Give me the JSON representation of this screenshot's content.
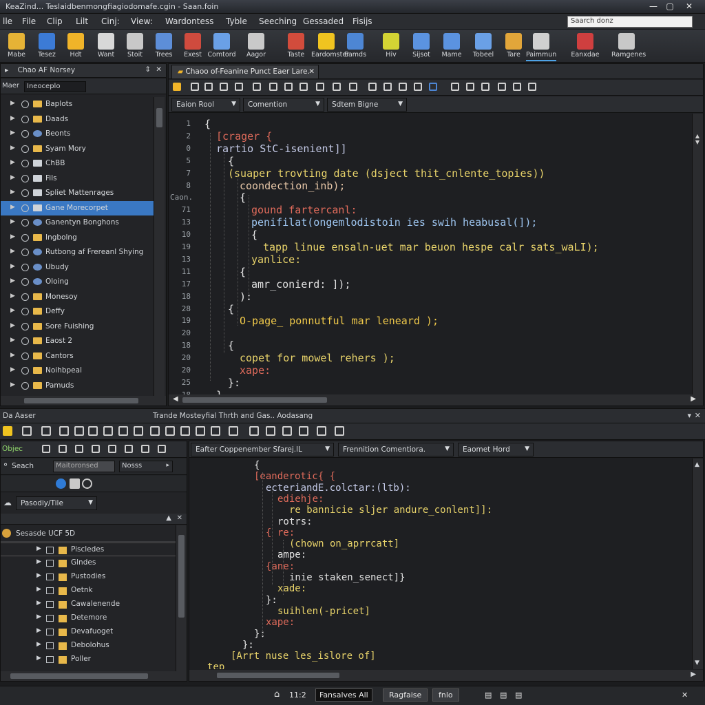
{
  "window": {
    "title": "KeaZind... Teslaidbenmongfiagiodomafe.cgin - Saan.foin"
  },
  "menu": [
    "lle",
    "File",
    "Clip",
    "Lilt",
    "Cinj:",
    "View:",
    "Wardontess",
    "Tyble",
    "Seeching",
    "Gessaded",
    "Fisijs"
  ],
  "search": {
    "placeholder": "Saarch donz"
  },
  "toolbar": [
    {
      "label": "Mabe",
      "color": "#e6b336"
    },
    {
      "label": "Tesez",
      "color": "#3c7bd6"
    },
    {
      "label": "Hdt",
      "color": "#f0b429"
    },
    {
      "label": "Want",
      "color": "#d8d8d8"
    },
    {
      "label": "Stoit",
      "color": "#c8c8c8"
    },
    {
      "label": "Trees",
      "color": "#5d8ed8"
    },
    {
      "label": "Exest",
      "color": "#cf4b3e"
    },
    {
      "label": "Comtord",
      "color": "#6aa0e6"
    },
    {
      "label": "Aagor",
      "color": "#c9c9c9"
    },
    {
      "label": "Taste",
      "color": "#d24c3c"
    },
    {
      "label": "Eardomster",
      "color": "#f0c420"
    },
    {
      "label": "Eamds",
      "color": "#4d86d4"
    },
    {
      "label": "Hiv",
      "color": "#d4d434"
    },
    {
      "label": "Sijsot",
      "color": "#5b93e0"
    },
    {
      "label": "Mame",
      "color": "#5b93e0"
    },
    {
      "label": "Tobeel",
      "color": "#6aa0e6"
    },
    {
      "label": "Tare",
      "color": "#e2a63a"
    },
    {
      "label": "Paimmun",
      "color": "#d0d0d0"
    },
    {
      "label": "Eanxdae",
      "color": "#cf3f3f"
    },
    {
      "label": "Ramgenes",
      "color": "#c8c8c8"
    }
  ],
  "left_panel": {
    "title": "Chao AF Norsey",
    "filter_label": "Maer",
    "filter_value": "Ineoceplo",
    "items": [
      {
        "label": "Baplots",
        "icon": "folder-icon",
        "selected": false
      },
      {
        "label": "Daads",
        "icon": "folder-icon",
        "selected": false
      },
      {
        "label": "Beonts",
        "icon": "gear-icon",
        "selected": false
      },
      {
        "label": "Syam Mory",
        "icon": "folder-icon",
        "selected": false
      },
      {
        "label": "ChBB",
        "icon": "file-icon",
        "selected": false
      },
      {
        "label": "Fils",
        "icon": "file-icon",
        "selected": false
      },
      {
        "label": "Spliet Mattenrages",
        "icon": "file-icon",
        "selected": false
      },
      {
        "label": "Gane Morecorpet",
        "icon": "file-icon",
        "selected": true
      },
      {
        "label": "Ganentyn Bonghons",
        "icon": "gear-icon",
        "selected": false
      },
      {
        "label": "Ingbolng",
        "icon": "folder-icon",
        "selected": false
      },
      {
        "label": "Rutbong af Frereanl Shying",
        "icon": "gear-icon",
        "selected": false
      },
      {
        "label": "Ubudy",
        "icon": "gear-icon",
        "selected": false
      },
      {
        "label": "Oloing",
        "icon": "gear-icon",
        "selected": false
      },
      {
        "label": "Monesoy",
        "icon": "folder-icon",
        "selected": false
      },
      {
        "label": "Deffy",
        "icon": "folder-icon",
        "selected": false
      },
      {
        "label": "Sore Fuishing",
        "icon": "folder-icon",
        "selected": false
      },
      {
        "label": "Eaost 2",
        "icon": "folder-icon",
        "selected": false
      },
      {
        "label": "Cantors",
        "icon": "folder-icon",
        "selected": false
      },
      {
        "label": "Noihbpeal",
        "icon": "folder-icon",
        "selected": false
      },
      {
        "label": "Pamuds",
        "icon": "folder-icon",
        "selected": false
      }
    ]
  },
  "editor": {
    "tab": "Chaoo of-Feanine Punct Eaer Lare.",
    "combos": [
      "Eaion Rool",
      "Comention",
      "Sdtem Bigne"
    ],
    "lines": [
      {
        "n": "1",
        "text": "{",
        "color": "#e8e8e8",
        "indent": 0
      },
      {
        "n": "2",
        "text": "[crager {",
        "color": "#e06b5b",
        "indent": 1
      },
      {
        "n": "0",
        "text": "rartio StC-isenient]]",
        "color": "#c5cbe8",
        "indent": 1
      },
      {
        "n": "5",
        "text": "{",
        "color": "#e8e8e8",
        "indent": 2
      },
      {
        "n": "7",
        "text": "(suaper trovting date (dsject thit_cnlente_topies))",
        "color": "#e8d36a",
        "indent": 2
      },
      {
        "n": "8",
        "text": "coondection_inb);",
        "color": "#e7c7a8",
        "indent": 3
      },
      {
        "n": "Caon.",
        "text": "{",
        "color": "#e8e8e8",
        "indent": 3
      },
      {
        "n": "71",
        "text": "gound fartercanl:",
        "color": "#e06b5b",
        "indent": 4
      },
      {
        "n": "13",
        "text": "penifilat(ongemlodistoin ies swih heabusal(]);",
        "color": "#9fc7f2",
        "indent": 4
      },
      {
        "n": "10",
        "text": "{",
        "color": "#e8e8e8",
        "indent": 4
      },
      {
        "n": "19",
        "text": "tapp linue ensaln-uet mar beuon hespe calr sats_waLI);",
        "color": "#e8d36a",
        "indent": 5
      },
      {
        "n": "13",
        "text": "yanlice:",
        "color": "#e8d36a",
        "indent": 4
      },
      {
        "n": "11",
        "text": "{",
        "color": "#e8e8e8",
        "indent": 3
      },
      {
        "n": "17",
        "text": "amr_conierd: ]);",
        "color": "#e0e0e0",
        "indent": 4
      },
      {
        "n": "18",
        "text": "):",
        "color": "#e8e8e8",
        "indent": 3
      },
      {
        "n": "28",
        "text": "{",
        "color": "#e8e8e8",
        "indent": 2
      },
      {
        "n": "19",
        "text": "O-page_ ponnutful mar leneard );",
        "color": "#f0c94a",
        "indent": 3
      },
      {
        "n": "20",
        "text": "",
        "color": "#e8e8e8",
        "indent": 3
      },
      {
        "n": "18",
        "text": "{",
        "color": "#e8e8e8",
        "indent": 2
      },
      {
        "n": "20",
        "text": "copet for mowel rehers );",
        "color": "#e8d36a",
        "indent": 3
      },
      {
        "n": "20",
        "text": "xape:",
        "color": "#e06b5b",
        "indent": 3
      },
      {
        "n": "25",
        "text": "}:",
        "color": "#e8e8e8",
        "indent": 2
      },
      {
        "n": "18",
        "text": "}",
        "color": "#e8e8e8",
        "indent": 1
      }
    ]
  },
  "bottom_bar": {
    "left": "Da Aaser",
    "center": "Trande Mosteyfial   Thrth and Gas..   Aodasang"
  },
  "bottom_left": {
    "tab": "Objec",
    "search_label": "Seach",
    "search_value": "Maitoronsed",
    "combo2": "Nosss",
    "dropdown": "Pasodiy/Tile",
    "tree_header": "Sesasde UCF 5D",
    "items": [
      {
        "label": "Piscledes",
        "selected": true
      },
      {
        "label": "Glndes",
        "selected": false
      },
      {
        "label": "Pustodies",
        "selected": false
      },
      {
        "label": "Oetnk",
        "selected": false
      },
      {
        "label": "Cawalenende",
        "selected": false
      },
      {
        "label": "Detemore",
        "selected": false
      },
      {
        "label": "Devafuoget",
        "selected": false
      },
      {
        "label": "Debolohus",
        "selected": false
      },
      {
        "label": "Poller",
        "selected": false
      }
    ]
  },
  "bottom_editor": {
    "combos": [
      "Eafter Coppenember Sfarej.lL",
      "Frennition Comentiora.",
      "Eaomet Hord"
    ],
    "lines": [
      {
        "text": "{",
        "color": "#e8e8e8",
        "indent": 4
      },
      {
        "text": "[eanderotic{ {",
        "color": "#e06b5b",
        "indent": 4
      },
      {
        "text": "ecteriandE.colctar:(ltb):",
        "color": "#c5cbe8",
        "indent": 5
      },
      {
        "text": "ediehje:",
        "color": "#e06b5b",
        "indent": 6
      },
      {
        "text": "re bannicie sljer andure_conlent]]:",
        "color": "#e8d36a",
        "indent": 7
      },
      {
        "text": "rotrs:",
        "color": "#e0e0e0",
        "indent": 6
      },
      {
        "text": "{ re:",
        "color": "#e06b5b",
        "indent": 5
      },
      {
        "text": "(chown on_aprrcatt]",
        "color": "#e8d36a",
        "indent": 7
      },
      {
        "text": "ampe:",
        "color": "#e0e0e0",
        "indent": 6
      },
      {
        "text": "{ane:",
        "color": "#e06b5b",
        "indent": 5
      },
      {
        "text": "inie staken_senect]}",
        "color": "#e0e0e0",
        "indent": 7
      },
      {
        "text": "xade:",
        "color": "#e8d36a",
        "indent": 6
      },
      {
        "text": "}:",
        "color": "#e8e8e8",
        "indent": 5
      },
      {
        "text": "suihlen(-pricet]",
        "color": "#e8d36a",
        "indent": 6
      },
      {
        "text": "xape:",
        "color": "#e06b5b",
        "indent": 5
      },
      {
        "text": "}:",
        "color": "#e8e8e8",
        "indent": 4
      },
      {
        "text": "}:",
        "color": "#e8e8e8",
        "indent": 3
      },
      {
        "text": "[Arrt nuse les_islore of]",
        "color": "#e8d36a",
        "indent": 2
      },
      {
        "text": "tep",
        "color": "#e8d36a",
        "indent": 0
      }
    ]
  },
  "status": {
    "pos": "11:2",
    "btn1": "Fansalves All",
    "btn2": "Ragfaise",
    "btn3": "fnlo"
  },
  "colors": {
    "accent": "#3a78c3",
    "folder": "#e8b84a"
  }
}
